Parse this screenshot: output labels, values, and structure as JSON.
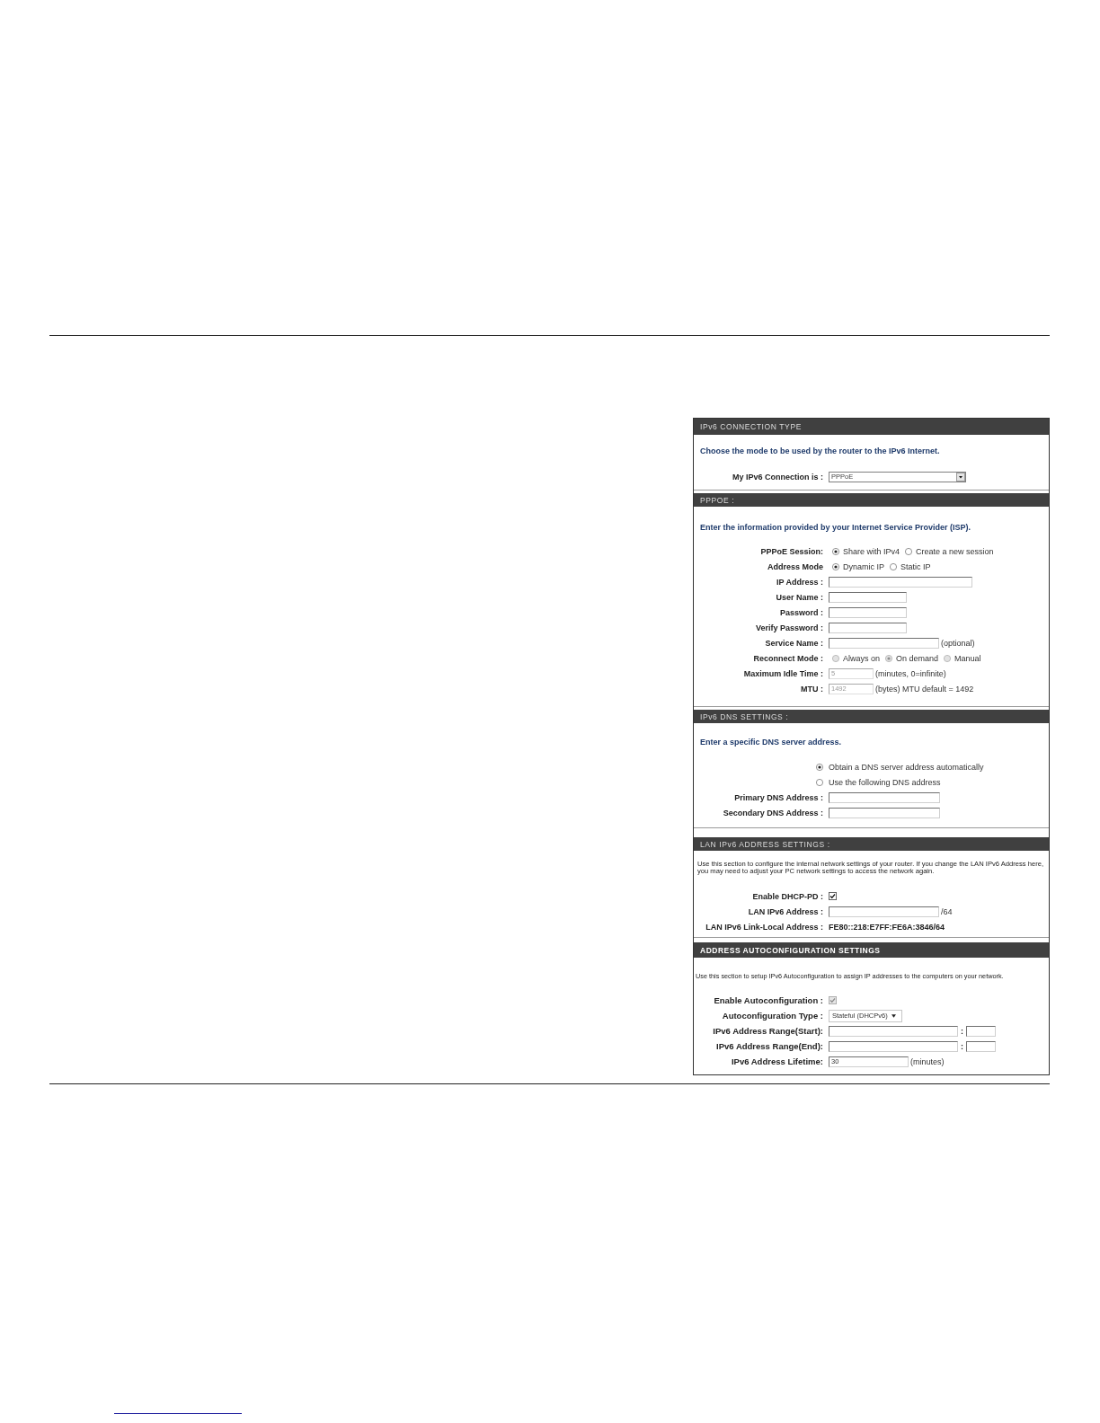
{
  "sections": [
    {
      "title": "IPv6 CONNECTION TYPE",
      "description": "Choose the mode to be used by the router to the IPv6 Internet.",
      "rows": [
        {
          "kind": "select",
          "label": "My IPv6 Connection is :",
          "value": "PPPoE"
        }
      ]
    },
    {
      "title": "PPPOE :",
      "description": "Enter the information provided by your Internet Service Provider (ISP).",
      "rows": [
        {
          "kind": "radios",
          "label": "PPPoE Session:",
          "options": [
            {
              "label": "Share with IPv4",
              "selected": true,
              "disabled": false
            },
            {
              "label": "Create a new session",
              "selected": false,
              "disabled": false
            }
          ]
        },
        {
          "kind": "radios",
          "label": "Address Mode",
          "options": [
            {
              "label": "Dynamic IP",
              "selected": true,
              "disabled": false
            },
            {
              "label": "Static IP",
              "selected": false,
              "disabled": false
            }
          ]
        },
        {
          "kind": "text",
          "label": "IP Address :",
          "disabled": false
        },
        {
          "kind": "text",
          "label": "User Name :",
          "disabled": false
        },
        {
          "kind": "text",
          "label": "Password :",
          "disabled": false
        },
        {
          "kind": "text",
          "label": "Verify Password :",
          "disabled": false
        },
        {
          "kind": "text",
          "label": "Service Name :",
          "disabled": false,
          "note": "(optional)"
        },
        {
          "kind": "radios",
          "label": "Reconnect Mode :",
          "options": [
            {
              "label": "Always on",
              "selected": false,
              "disabled": true
            },
            {
              "label": "On demand",
              "selected": true,
              "disabled": true
            },
            {
              "label": "Manual",
              "selected": false,
              "disabled": true
            }
          ]
        },
        {
          "kind": "text",
          "label": "Maximum Idle Time :",
          "value": "5",
          "disabled": true,
          "note": "(minutes, 0=infinite)"
        },
        {
          "kind": "text",
          "label": "MTU :",
          "value": "1492",
          "disabled": true,
          "note": "(bytes) MTU default = 1492"
        }
      ]
    },
    {
      "title": "IPv6 DNS SETTINGS :",
      "description": "Enter a specific DNS server address.",
      "rows": [
        {
          "kind": "radio",
          "label": "Obtain a DNS server address automatically",
          "selected": true
        },
        {
          "kind": "radio",
          "label": "Use the following DNS address",
          "selected": false
        },
        {
          "kind": "text",
          "label": "Primary DNS Address :",
          "disabled": false
        },
        {
          "kind": "text",
          "label": "Secondary DNS Address :",
          "disabled": false
        }
      ]
    },
    {
      "title": "LAN IPv6 ADDRESS SETTINGS :",
      "description": "Use this section to configure the internal network settings of your router. If you change the LAN IPv6 Address here, you may need to adjust your PC network settings to access the network again.",
      "rows": [
        {
          "kind": "checkbox",
          "label": "Enable DHCP-PD :",
          "checked": true,
          "disabled": false
        },
        {
          "kind": "text",
          "label": "LAN IPv6 Address :",
          "disabled": false,
          "note": "/64"
        },
        {
          "kind": "static",
          "label": "LAN IPv6 Link-Local Address :",
          "value": "FE80::218:E7FF:FE6A:3846/64"
        }
      ]
    },
    {
      "title": "ADDRESS AUTOCONFIGURATION SETTINGS",
      "description": "Use this section to setup IPv6 Autoconfiguration to assign IP addresses to the computers on your network.",
      "rows": [
        {
          "kind": "checkbox",
          "label": "Enable Autoconfiguration :",
          "checked": true,
          "disabled": true
        },
        {
          "kind": "dropdown",
          "label": "Autoconfiguration Type :",
          "value": "Stateful (DHCPv6)"
        },
        {
          "kind": "range",
          "label": "IPv6 Address Range(Start):",
          "separator": ":"
        },
        {
          "kind": "range",
          "label": "IPv6 Address Range(End):",
          "separator": ":"
        },
        {
          "kind": "text",
          "label": "IPv6 Address Lifetime:",
          "value": "30",
          "disabled": false,
          "note": "(minutes)"
        }
      ]
    }
  ]
}
